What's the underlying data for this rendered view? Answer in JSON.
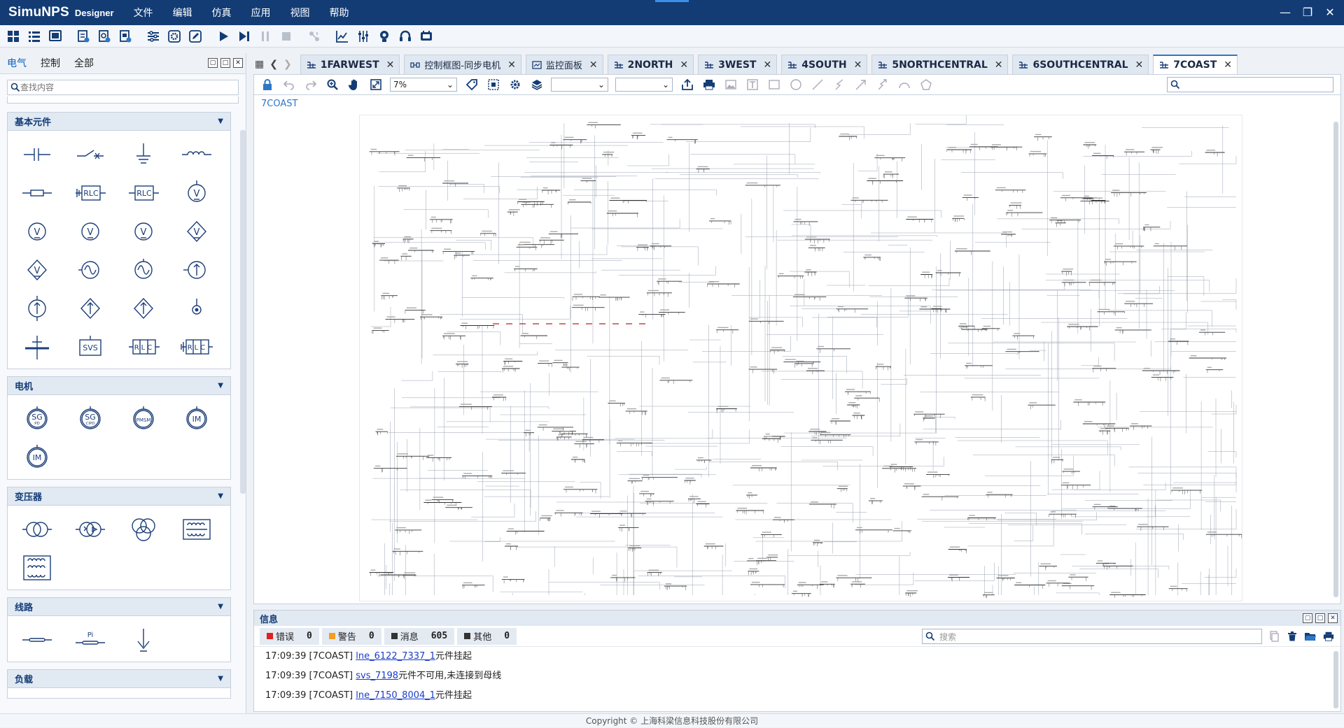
{
  "app": {
    "logo_main": "SimuNPS",
    "logo_sub": "Designer"
  },
  "menu": [
    "文件",
    "编辑",
    "仿真",
    "应用",
    "视图",
    "帮助"
  ],
  "window_controls": [
    "minimize-icon",
    "restore-icon",
    "close-icon"
  ],
  "toolbar_icons": [
    "grid-icon",
    "list-icon",
    "monitor-icon",
    "new-model-icon",
    "new-control-icon",
    "new-panel-icon",
    "config-icon",
    "settings-gear-icon",
    "edit-icon",
    "run-icon",
    "step-icon",
    "pause-icon",
    "stop-icon",
    "connect-icon",
    "chart-icon",
    "sliders-icon",
    "lightbulb-icon",
    "headset-icon",
    "device-icon"
  ],
  "left_panel": {
    "tabs": [
      "电气",
      "控制",
      "全部"
    ],
    "active_tab": 0,
    "search_placeholder": "查找内容",
    "categories": [
      {
        "title": "基本元件",
        "items": [
          {
            "icon": "capacitor-icon"
          },
          {
            "icon": "switch-icon"
          },
          {
            "icon": "ground-icon"
          },
          {
            "icon": "inductor-icon"
          },
          {
            "icon": "resistor-icon"
          },
          {
            "icon": "rlc-branch-grounded-icon",
            "text": "RLC"
          },
          {
            "icon": "rlc-branch-icon",
            "text": "RLC"
          },
          {
            "icon": "voltage-source-grounded-icon",
            "text": "V"
          },
          {
            "icon": "voltage-source-icon",
            "text": "V"
          },
          {
            "icon": "voltage-source-2-icon",
            "text": "V"
          },
          {
            "icon": "voltage-source-3-icon",
            "text": "V"
          },
          {
            "icon": "controlled-voltage-source-icon",
            "text": "V"
          },
          {
            "icon": "controlled-voltage-source-2-icon",
            "text": "V"
          },
          {
            "icon": "ac-source-icon"
          },
          {
            "icon": "ac-source-2-icon"
          },
          {
            "icon": "current-source-icon"
          },
          {
            "icon": "current-source-2-icon"
          },
          {
            "icon": "controlled-current-source-icon"
          },
          {
            "icon": "controlled-current-source-2-icon"
          },
          {
            "icon": "node-icon"
          },
          {
            "icon": "busbar-icon"
          },
          {
            "icon": "svs-icon",
            "text": "SVS"
          },
          {
            "icon": "rlc-three-phase-icon",
            "text": "RLC"
          },
          {
            "icon": "rlc-three-phase-grounded-icon",
            "text": "RLC"
          }
        ]
      },
      {
        "title": "电机",
        "items": [
          {
            "icon": "sg-pd-icon",
            "text": "SG",
            "sub": "PD"
          },
          {
            "icon": "sg-cipd-icon",
            "text": "SG",
            "sub": "CIPD"
          },
          {
            "icon": "pmsm-icon",
            "text": "PMSM"
          },
          {
            "icon": "im-icon",
            "text": "IM"
          },
          {
            "icon": "im-2-icon",
            "text": "IM"
          }
        ]
      },
      {
        "title": "变压器",
        "items": [
          {
            "icon": "transformer-2w-icon"
          },
          {
            "icon": "transformer-2w-yd-icon"
          },
          {
            "icon": "transformer-3w-icon"
          },
          {
            "icon": "transformer-core-icon"
          },
          {
            "icon": "transformer-core-3w-icon"
          }
        ]
      },
      {
        "title": "线路",
        "items": [
          {
            "icon": "line-icon"
          },
          {
            "icon": "pi-line-icon",
            "text": "Pi"
          },
          {
            "icon": "line-ground-icon"
          }
        ]
      },
      {
        "title": "负载",
        "items": []
      }
    ]
  },
  "doc_tabs": [
    {
      "label": "1FARWEST",
      "icon": "model-tab-icon"
    },
    {
      "label": "控制框图-同步电机",
      "icon": "control-tab-icon"
    },
    {
      "label": "监控面板",
      "icon": "panel-tab-icon"
    },
    {
      "label": "2NORTH",
      "icon": "model-tab-icon"
    },
    {
      "label": "3WEST",
      "icon": "model-tab-icon"
    },
    {
      "label": "4SOUTH",
      "icon": "model-tab-icon"
    },
    {
      "label": "5NORTHCENTRAL",
      "icon": "model-tab-icon"
    },
    {
      "label": "6SOUTHCENTRAL",
      "icon": "model-tab-icon"
    },
    {
      "label": "7COAST",
      "icon": "model-tab-icon"
    }
  ],
  "active_doc_tab": 8,
  "editor": {
    "zoom": "7%",
    "select1": "",
    "select2": "",
    "search_value": "",
    "breadcrumb": "7COAST"
  },
  "info": {
    "title": "信息",
    "filters": [
      {
        "label": "错误",
        "count": "0",
        "color": "#e02020"
      },
      {
        "label": "警告",
        "count": "0",
        "color": "#f0a020"
      },
      {
        "label": "消息",
        "count": "605",
        "color": "#333333"
      },
      {
        "label": "其他",
        "count": "0",
        "color": "#333333"
      }
    ],
    "search_placeholder": "搜索",
    "logs": [
      {
        "time": "17:09:39 [7COAST] ",
        "link": "lne_6122_7337_1",
        "msg": "元件挂起"
      },
      {
        "time": "17:09:39 [7COAST] ",
        "link": "svs_7198",
        "msg": "元件不可用,未连接到母线"
      },
      {
        "time": "17:09:39 [7COAST] ",
        "link": "lne_7150_8004_1",
        "msg": "元件挂起"
      }
    ]
  },
  "footer": "Copyright © 上海科梁信息科技股份有限公司"
}
